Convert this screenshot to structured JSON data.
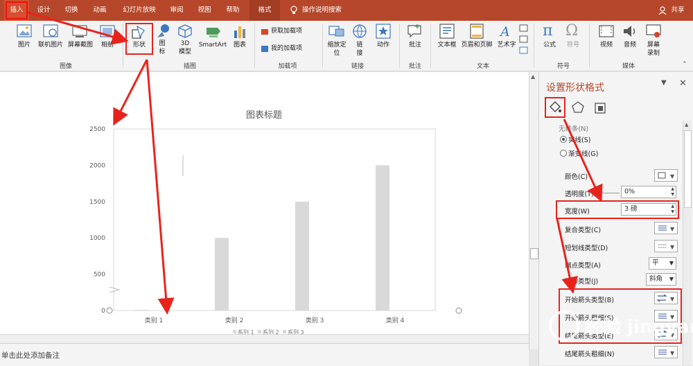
{
  "tabs": [
    "插入",
    "设计",
    "切换",
    "动画",
    "幻灯片放映",
    "审阅",
    "视图",
    "帮助",
    "格式"
  ],
  "tell_me": "操作说明搜索",
  "share": "共享",
  "ribbon": {
    "groups": {
      "images": "图像",
      "illustrations": "插图",
      "addins": "加载项",
      "links": "链接",
      "comments": "批注",
      "text": "文本",
      "symbols": "符号",
      "media": "媒体"
    },
    "buttons": {
      "picture": "图片",
      "online_picture": "联机图片",
      "screenshot": "屏幕截图",
      "album": "相册",
      "shapes": "形状",
      "icons_1": "图",
      "icons_2": "标",
      "model3d_1": "3D",
      "model3d_2": "模型",
      "smartart": "SmartArt",
      "chart": "图表",
      "get_addins": "获取加载项",
      "my_addins": "我的加载项",
      "zoom_1": "缩放定",
      "zoom_2": "位",
      "link_1": "链",
      "link_2": "接",
      "action": "动作",
      "comment": "批注",
      "textbox": "文本框",
      "header_footer": "页眉和页脚",
      "wordart": "艺术字",
      "equation": "公式",
      "symbol": "符号",
      "video": "视频",
      "audio": "音频",
      "screen_rec_1": "屏幕",
      "screen_rec_2": "录制"
    }
  },
  "pane": {
    "title": "设置形状格式",
    "fill_none_partial": "无线条(N)",
    "solid_line": "实线(S)",
    "gradient_line": "渐变线(G)",
    "color_label": "颜色(C)",
    "transparency_label": "透明度(T)",
    "transparency_value": "0%",
    "width_label": "宽度(W)",
    "width_value": "3 磅",
    "compound_label": "复合类型(C)",
    "dash_label": "短划线类型(D)",
    "cap_label": "端点类型(A)",
    "cap_value": "平",
    "join_label": "连接类型(J)",
    "join_value": "斜角",
    "begin_arrow_type": "开始箭头类型(B)",
    "begin_arrow_size": "开始箭头粗细(S)",
    "end_arrow_type": "结尾箭头类型(E)",
    "end_arrow_size": "结尾箭头粗细(N)"
  },
  "notes_placeholder": "单击此处添加备注",
  "watermark": "经验 jingyan.baidu.com",
  "colors": {
    "accent": "#b7472a",
    "highlight": "#e8231c",
    "bar": "#d9d9d9"
  },
  "chart_data": {
    "type": "bar",
    "title": "图表标题",
    "categories": [
      "类别 1",
      "类别 2",
      "类别 3",
      "类别 4"
    ],
    "values": [
      0,
      1000,
      1500,
      2000
    ],
    "ylim": [
      0,
      2500
    ],
    "yticks": [
      0,
      500,
      1000,
      1500,
      2000,
      2500
    ],
    "legend": [
      "系列 1",
      "系列 2",
      "系列 3"
    ],
    "legend_position": "bottom",
    "grid": false
  }
}
